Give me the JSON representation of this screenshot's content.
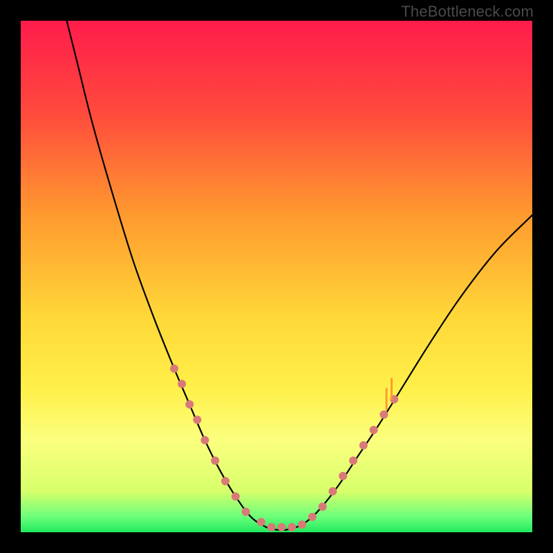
{
  "watermark": "TheBottleneck.com",
  "chart_data": {
    "type": "line",
    "title": "",
    "xlabel": "",
    "ylabel": "",
    "xlim": [
      0,
      100
    ],
    "ylim": [
      0,
      100
    ],
    "gradient_stops": [
      {
        "pct": 0,
        "color": "#ff1c4b"
      },
      {
        "pct": 18,
        "color": "#ff4a3d"
      },
      {
        "pct": 38,
        "color": "#ff9a2f"
      },
      {
        "pct": 58,
        "color": "#ffd838"
      },
      {
        "pct": 72,
        "color": "#fff04a"
      },
      {
        "pct": 82,
        "color": "#fbff7e"
      },
      {
        "pct": 92,
        "color": "#d7ff6a"
      },
      {
        "pct": 97,
        "color": "#6bff7a"
      },
      {
        "pct": 100,
        "color": "#1fea5e"
      }
    ],
    "series": [
      {
        "name": "bottleneck-curve",
        "stroke": "#000000",
        "stroke_width": 2.2,
        "points": [
          {
            "x": 9.0,
            "y": 100.0
          },
          {
            "x": 11.0,
            "y": 92.0
          },
          {
            "x": 14.0,
            "y": 80.0
          },
          {
            "x": 18.0,
            "y": 66.0
          },
          {
            "x": 22.0,
            "y": 53.0
          },
          {
            "x": 26.0,
            "y": 42.0
          },
          {
            "x": 30.0,
            "y": 32.0
          },
          {
            "x": 33.0,
            "y": 25.0
          },
          {
            "x": 36.0,
            "y": 18.0
          },
          {
            "x": 39.0,
            "y": 12.0
          },
          {
            "x": 42.0,
            "y": 7.0
          },
          {
            "x": 45.0,
            "y": 3.0
          },
          {
            "x": 48.0,
            "y": 1.0
          },
          {
            "x": 50.0,
            "y": 0.5
          },
          {
            "x": 52.0,
            "y": 0.5
          },
          {
            "x": 55.0,
            "y": 1.5
          },
          {
            "x": 58.0,
            "y": 4.0
          },
          {
            "x": 62.0,
            "y": 9.0
          },
          {
            "x": 66.0,
            "y": 15.0
          },
          {
            "x": 70.0,
            "y": 21.0
          },
          {
            "x": 75.0,
            "y": 29.0
          },
          {
            "x": 80.0,
            "y": 37.0
          },
          {
            "x": 86.0,
            "y": 46.0
          },
          {
            "x": 93.0,
            "y": 55.0
          },
          {
            "x": 100.0,
            "y": 62.0
          }
        ]
      }
    ],
    "markers": {
      "color": "#d87a78",
      "radius": 6,
      "points": [
        {
          "x": 30.0,
          "y": 32.0
        },
        {
          "x": 31.5,
          "y": 29.0
        },
        {
          "x": 33.0,
          "y": 25.0
        },
        {
          "x": 34.5,
          "y": 22.0
        },
        {
          "x": 36.0,
          "y": 18.0
        },
        {
          "x": 38.0,
          "y": 14.0
        },
        {
          "x": 40.0,
          "y": 10.0
        },
        {
          "x": 42.0,
          "y": 7.0
        },
        {
          "x": 44.0,
          "y": 4.0
        },
        {
          "x": 47.0,
          "y": 2.0
        },
        {
          "x": 49.0,
          "y": 1.0
        },
        {
          "x": 51.0,
          "y": 1.0
        },
        {
          "x": 53.0,
          "y": 1.0
        },
        {
          "x": 55.0,
          "y": 1.5
        },
        {
          "x": 57.0,
          "y": 3.0
        },
        {
          "x": 59.0,
          "y": 5.0
        },
        {
          "x": 61.0,
          "y": 8.0
        },
        {
          "x": 63.0,
          "y": 11.0
        },
        {
          "x": 65.0,
          "y": 14.0
        },
        {
          "x": 67.0,
          "y": 17.0
        },
        {
          "x": 69.0,
          "y": 20.0
        },
        {
          "x": 71.0,
          "y": 23.0
        },
        {
          "x": 73.0,
          "y": 26.0
        }
      ]
    },
    "orange_bars": {
      "color": "#ff9a2f",
      "width": 3,
      "segments": [
        {
          "x": 71.5,
          "y0": 24.0,
          "y1": 28.0
        },
        {
          "x": 72.5,
          "y0": 26.0,
          "y1": 30.0
        }
      ]
    }
  }
}
